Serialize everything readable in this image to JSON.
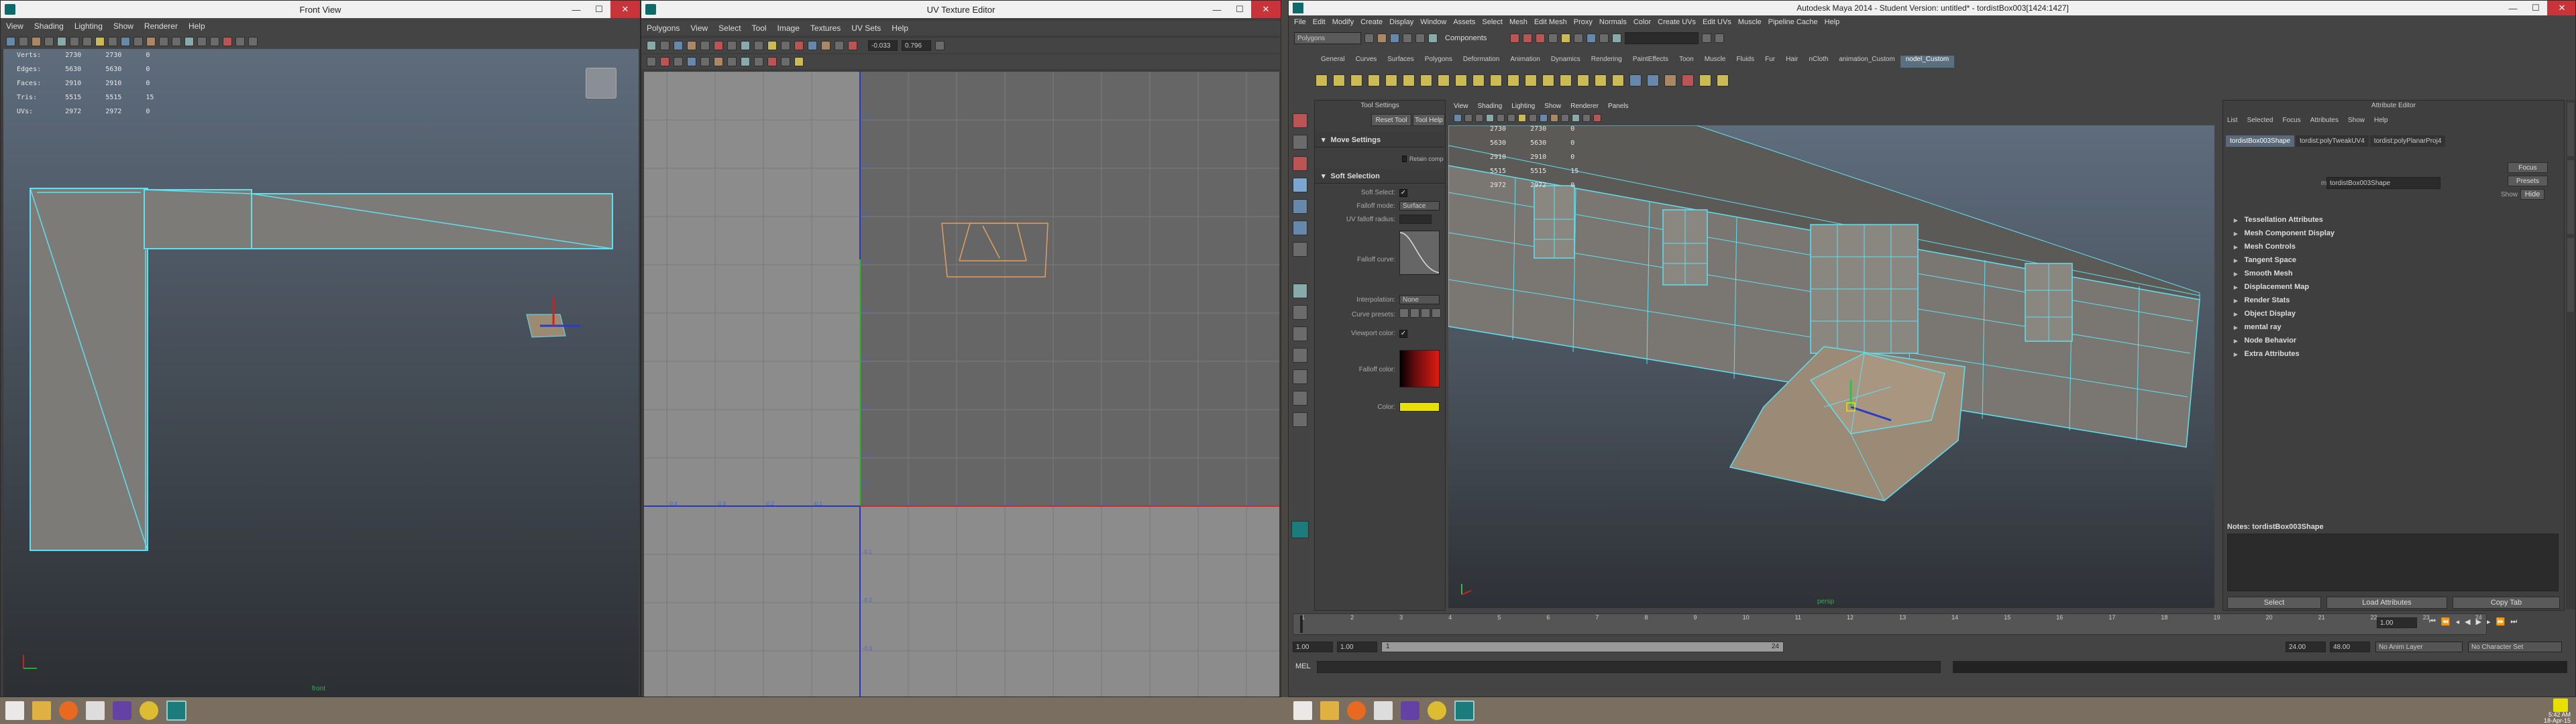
{
  "front_view": {
    "title": "Front View",
    "menu": [
      "View",
      "Shading",
      "Lighting",
      "Show",
      "Renderer",
      "Help"
    ],
    "hud": [
      {
        "label": "Verts:",
        "v1": "2730",
        "v2": "2730",
        "v3": "0"
      },
      {
        "label": "Edges:",
        "v1": "5630",
        "v2": "5630",
        "v3": "0"
      },
      {
        "label": "Faces:",
        "v1": "2910",
        "v2": "2910",
        "v3": "0"
      },
      {
        "label": "Tris:",
        "v1": "5515",
        "v2": "5515",
        "v3": "15"
      },
      {
        "label": "UVs:",
        "v1": "2972",
        "v2": "2972",
        "v3": "0"
      }
    ],
    "camera_label": "front"
  },
  "uv_editor": {
    "title": "UV Texture Editor",
    "menu": [
      "Polygons",
      "View",
      "Select",
      "Tool",
      "Image",
      "Textures",
      "UV Sets",
      "Help"
    ],
    "field_u": "-0.033",
    "field_v": "0.796",
    "x_ticks": [
      "-0.4",
      "-0.3",
      "-0.2",
      "-0.1",
      "0.1",
      "0.2",
      "0.3",
      "0.4",
      "0.5",
      "0.6",
      "0.7",
      "0.8"
    ],
    "y_ticks": [
      "0.9",
      "0.8",
      "0.7",
      "0.6",
      "0.5",
      "0.4",
      "0.3",
      "0.2",
      "0.1",
      "-0.1",
      "-0.2",
      "-0.3"
    ]
  },
  "maya": {
    "title": "Autodesk Maya 2014 - Student Version: untitled*   -   tordistBox003[1424:1427]",
    "menu": [
      "File",
      "Edit",
      "Modify",
      "Create",
      "Display",
      "Window",
      "Assets",
      "Select",
      "Mesh",
      "Edit Mesh",
      "Proxy",
      "Normals",
      "Color",
      "Create UVs",
      "Edit UVs",
      "Muscle",
      "Pipeline Cache",
      "Help"
    ],
    "mode_select": "Polygons",
    "components_label": "Components",
    "shelf_tabs": [
      "General",
      "Curves",
      "Surfaces",
      "Polygons",
      "Deformation",
      "Animation",
      "Dynamics",
      "Rendering",
      "PaintEffects",
      "Toon",
      "Muscle",
      "Fluids",
      "Fur",
      "Hair",
      "nCloth",
      "animation_Custom",
      "nodel_Custom"
    ],
    "active_shelf": "nodel_Custom",
    "tool_settings": {
      "title": "Tool Settings",
      "reset_tool": "Reset Tool",
      "tool_help": "Tool Help",
      "move_settings": "Move Settings",
      "retain_component": "Retain component sp",
      "soft_selection": "Soft Selection",
      "soft_select_label": "Soft Select:",
      "falloff_mode_label": "Falloff mode:",
      "falloff_mode_value": "Surface",
      "falloff_radius_label": "UV falloff radius:",
      "falloff_curve_label": "Falloff curve:",
      "interpolation_label": "Interpolation:",
      "interpolation_value": "None",
      "curve_presets_label": "Curve presets:",
      "viewport_color_label": "Viewport color:",
      "falloff_color_label": "Falloff color:",
      "color_label": "Color:",
      "accent_yellow": "#e8e000"
    },
    "viewport": {
      "menu": [
        "View",
        "Shading",
        "Lighting",
        "Show",
        "Renderer",
        "Panels"
      ],
      "hud": [
        {
          "v1": "2730",
          "v2": "2730",
          "v3": "0"
        },
        {
          "v1": "5630",
          "v2": "5630",
          "v3": "0"
        },
        {
          "v1": "2910",
          "v2": "2910",
          "v3": "0"
        },
        {
          "v1": "5515",
          "v2": "5515",
          "v3": "15"
        },
        {
          "v1": "2972",
          "v2": "2972",
          "v3": "0"
        }
      ],
      "camera_label": "persp"
    },
    "attribute_editor": {
      "title": "Attribute Editor",
      "menu": [
        "List",
        "Selected",
        "Focus",
        "Attributes",
        "Show",
        "Help"
      ],
      "tabs": [
        "tordistBox003Shape",
        "tordist:polyTweakUV4",
        "tordist:polyPlanarProj4"
      ],
      "mesh_label": "mesh:",
      "mesh_value": "tordistBox003Shape",
      "focus_btn": "Focus",
      "presets_btn": "Presets",
      "show_btn": "Show",
      "hide_btn": "Hide",
      "sections": [
        "Tessellation Attributes",
        "Mesh Component Display",
        "Mesh Controls",
        "Tangent Space",
        "Smooth Mesh",
        "Displacement Map",
        "Render Stats",
        "Object Display",
        "mental ray",
        "Node Behavior",
        "Extra Attributes"
      ],
      "notes_label": "Notes:  tordistBox003Shape",
      "select_btn": "Select",
      "load_attributes_btn": "Load Attributes",
      "copy_tab_btn": "Copy Tab"
    },
    "timeline": {
      "ticks": [
        "1",
        "2",
        "3",
        "4",
        "5",
        "6",
        "7",
        "8",
        "9",
        "10",
        "11",
        "12",
        "13",
        "14",
        "15",
        "16",
        "17",
        "18",
        "19",
        "20",
        "21",
        "22",
        "23",
        "24"
      ],
      "current_frame": "1.00",
      "start_time": "1.00",
      "start_range": "1.00",
      "range_start_marker": "1",
      "range_end_marker": "24",
      "end_range": "24.00",
      "end_time": "48.00",
      "anim_layer": "No Anim Layer",
      "character_set": "No Character Set"
    },
    "command_line_label": "MEL"
  },
  "taskbar": {
    "clock_time": "5:42 AM",
    "clock_date": "18-Apr-15"
  }
}
